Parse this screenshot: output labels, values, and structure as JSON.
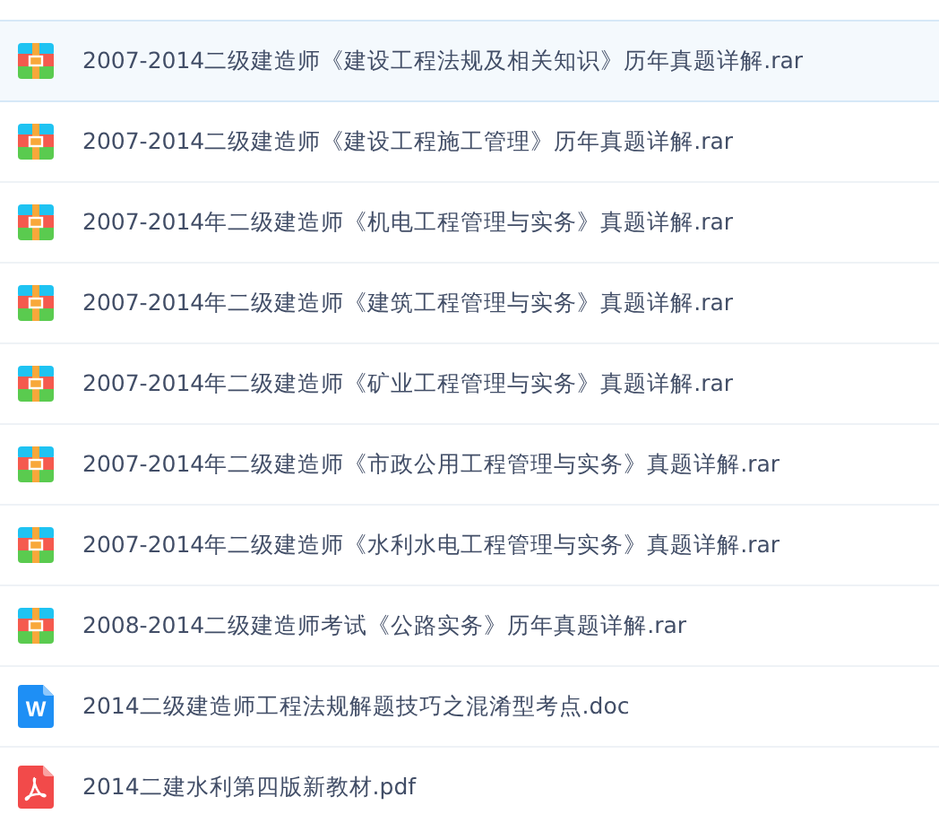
{
  "files": [
    {
      "name": "2007-2014二级建造师《建设工程法规及相关知识》历年真题详解.rar",
      "kind": "rar",
      "selected": true
    },
    {
      "name": "2007-2014二级建造师《建设工程施工管理》历年真题详解.rar",
      "kind": "rar",
      "selected": false
    },
    {
      "name": "2007-2014年二级建造师《机电工程管理与实务》真题详解.rar",
      "kind": "rar",
      "selected": false
    },
    {
      "name": "2007-2014年二级建造师《建筑工程管理与实务》真题详解.rar",
      "kind": "rar",
      "selected": false
    },
    {
      "name": "2007-2014年二级建造师《矿业工程管理与实务》真题详解.rar",
      "kind": "rar",
      "selected": false
    },
    {
      "name": "2007-2014年二级建造师《市政公用工程管理与实务》真题详解.rar",
      "kind": "rar",
      "selected": false
    },
    {
      "name": "2007-2014年二级建造师《水利水电工程管理与实务》真题详解.rar",
      "kind": "rar",
      "selected": false
    },
    {
      "name": "2008-2014二级建造师考试《公路实务》历年真题详解.rar",
      "kind": "rar",
      "selected": false
    },
    {
      "name": "2014二级建造师工程法规解题技巧之混淆型考点.doc",
      "kind": "doc",
      "icon_text": "W",
      "selected": false
    },
    {
      "name": "2014二建水利第四版新教材.pdf",
      "kind": "pdf",
      "selected": false
    }
  ]
}
